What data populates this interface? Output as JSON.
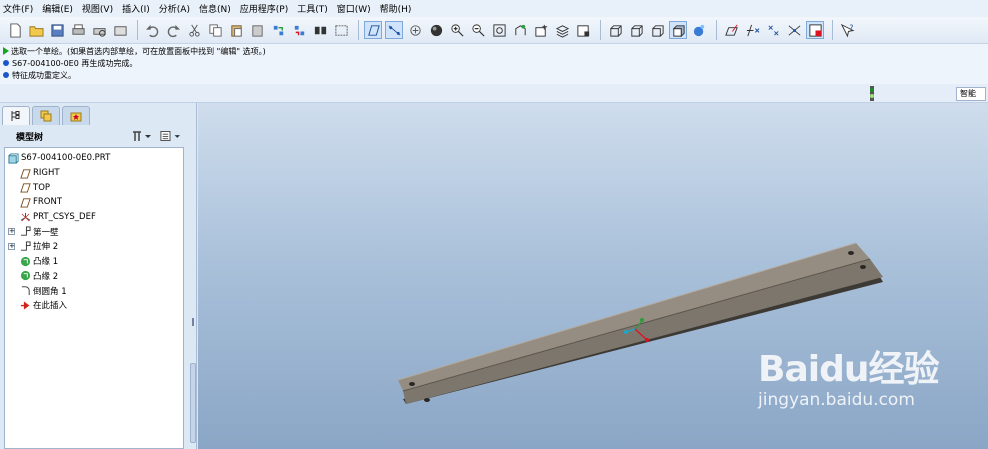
{
  "menubar": {
    "items": [
      "文件(F)",
      "编辑(E)",
      "视图(V)",
      "插入(I)",
      "分析(A)",
      "信息(N)",
      "应用程序(P)",
      "工具(T)",
      "窗口(W)",
      "帮助(H)"
    ]
  },
  "toolbar": {
    "icons": [
      "new-file-icon",
      "open-file-icon",
      "save-icon",
      "print-icon",
      "print-preview-icon",
      "close-window-icon",
      "undo-icon",
      "redo-icon",
      "cut-icon",
      "copy-icon",
      "paste-icon",
      "paste-special-icon",
      "regenerate-icon",
      "regen-manager-icon",
      "find-icon",
      "select-box-icon",
      "datum-plane-display-icon",
      "datum-axis-display-icon",
      "datum-point-display-icon",
      "csys-display-icon",
      "zoom-in-icon",
      "zoom-out-icon",
      "refit-icon",
      "reorient-icon",
      "saved-views-icon",
      "layers-icon",
      "view-manager-icon",
      "wireframe-icon",
      "hidden-line-icon",
      "no-hidden-icon",
      "shading-icon",
      "enhanced-realism-icon",
      "sketch-tool-icon",
      "datum-plane-tool-icon",
      "datum-axis-tool-icon",
      "datum-point-tool-icon",
      "csys-tool-icon",
      "whats-this-icon"
    ]
  },
  "messages": [
    {
      "type": "prompt",
      "text": "选取一个草绘。(如果首选内部草绘，可在放置面板中找到 \"编辑\" 选项。)"
    },
    {
      "type": "info",
      "text": "S67-004100-0E0 再生成功完成。"
    },
    {
      "type": "info",
      "text": "特征成功重定义。"
    }
  ],
  "statusbar": {
    "filter_value": "智能"
  },
  "model_tree": {
    "title": "模型树",
    "nodes": [
      {
        "label": "S67-004100-0E0.PRT",
        "icon": "part-icon",
        "level": 0,
        "expandable": false
      },
      {
        "label": "RIGHT",
        "icon": "datum-plane-icon",
        "level": 1,
        "expandable": false
      },
      {
        "label": "TOP",
        "icon": "datum-plane-icon",
        "level": 1,
        "expandable": false
      },
      {
        "label": "FRONT",
        "icon": "datum-plane-icon",
        "level": 1,
        "expandable": false
      },
      {
        "label": "PRT_CSYS_DEF",
        "icon": "csys-icon",
        "level": 1,
        "expandable": false
      },
      {
        "label": "第一壁",
        "icon": "sheetmetal-wall-icon",
        "level": 1,
        "expandable": true
      },
      {
        "label": "拉伸 2",
        "icon": "extrude-icon",
        "level": 1,
        "expandable": true
      },
      {
        "label": "凸缘 1",
        "icon": "flange-icon",
        "level": 1,
        "expandable": false
      },
      {
        "label": "凸缘 2",
        "icon": "flange-icon",
        "level": 1,
        "expandable": false
      },
      {
        "label": "倒圆角 1",
        "icon": "round-icon",
        "level": 1,
        "expandable": false
      },
      {
        "label": "在此插入",
        "icon": "insert-here-arrow-icon",
        "level": 1,
        "expandable": false
      }
    ]
  },
  "watermark": {
    "logo": "Baidu经验",
    "url": "jingyan.baidu.com"
  },
  "colors": {
    "part_surface": "#8f877c",
    "viewport_top": "#cfdded",
    "viewport_bottom": "#8aa6c6",
    "insert_arrow": "#d0251c"
  }
}
